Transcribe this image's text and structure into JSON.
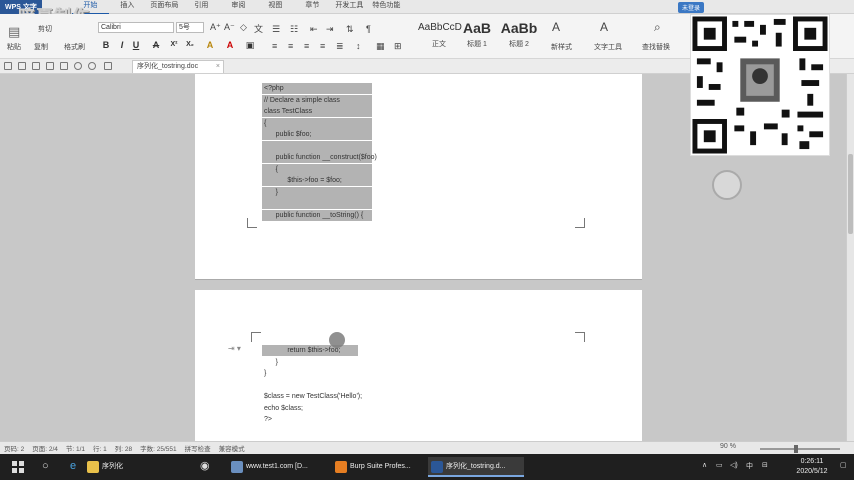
{
  "app": {
    "logo": "WPS 文字",
    "watermark": "暗夏制作",
    "login": "未登录"
  },
  "menu": [
    "开始",
    "插入",
    "页面布局",
    "引用",
    "审阅",
    "视图",
    "章节",
    "开发工具",
    "特色功能"
  ],
  "ribbon": {
    "paste": "粘贴",
    "cut": "剪切",
    "copy": "复制",
    "format_painter": "格式刷",
    "font": "Calibri",
    "size": "5号",
    "styles": [
      {
        "preview": "AaBbCcD",
        "label": "正文"
      },
      {
        "preview": "AaB",
        "label": "标题 1"
      },
      {
        "preview": "AaBb",
        "label": "标题 2"
      }
    ],
    "new_style": "新样式",
    "text_tools": "文字工具",
    "find_replace": "查找替换"
  },
  "document": {
    "tab_title": "序列化_tostring.doc",
    "page1_lines": [
      "<?php",
      "// Declare a simple class",
      "class TestClass",
      "{",
      "      public $foo;",
      "",
      "      public function __construct($foo)",
      "      {",
      "            $this->foo = $foo;",
      "      }",
      "",
      "      public function __toString() {"
    ],
    "page2_lines": [
      "            return $this->foo;",
      "      }",
      "}",
      "",
      "$class = new TestClass('Hello');",
      "echo $class;",
      "?>"
    ]
  },
  "status": {
    "page": "页码: 2",
    "pages": "页面: 2/4",
    "section": "节: 1/1",
    "row": "行: 1",
    "col": "列: 28",
    "words": "字数: 25/551",
    "spell": "拼写检查",
    "compat": "兼容模式",
    "zoom": "90 %"
  },
  "taskbar": {
    "apps": [
      "序列化",
      "www.test1.com [D...",
      "Burp Suite Profes...",
      "序列化_tostring.d..."
    ],
    "time": "0:26:11",
    "date": "2020/5/12",
    "ime": "中"
  }
}
